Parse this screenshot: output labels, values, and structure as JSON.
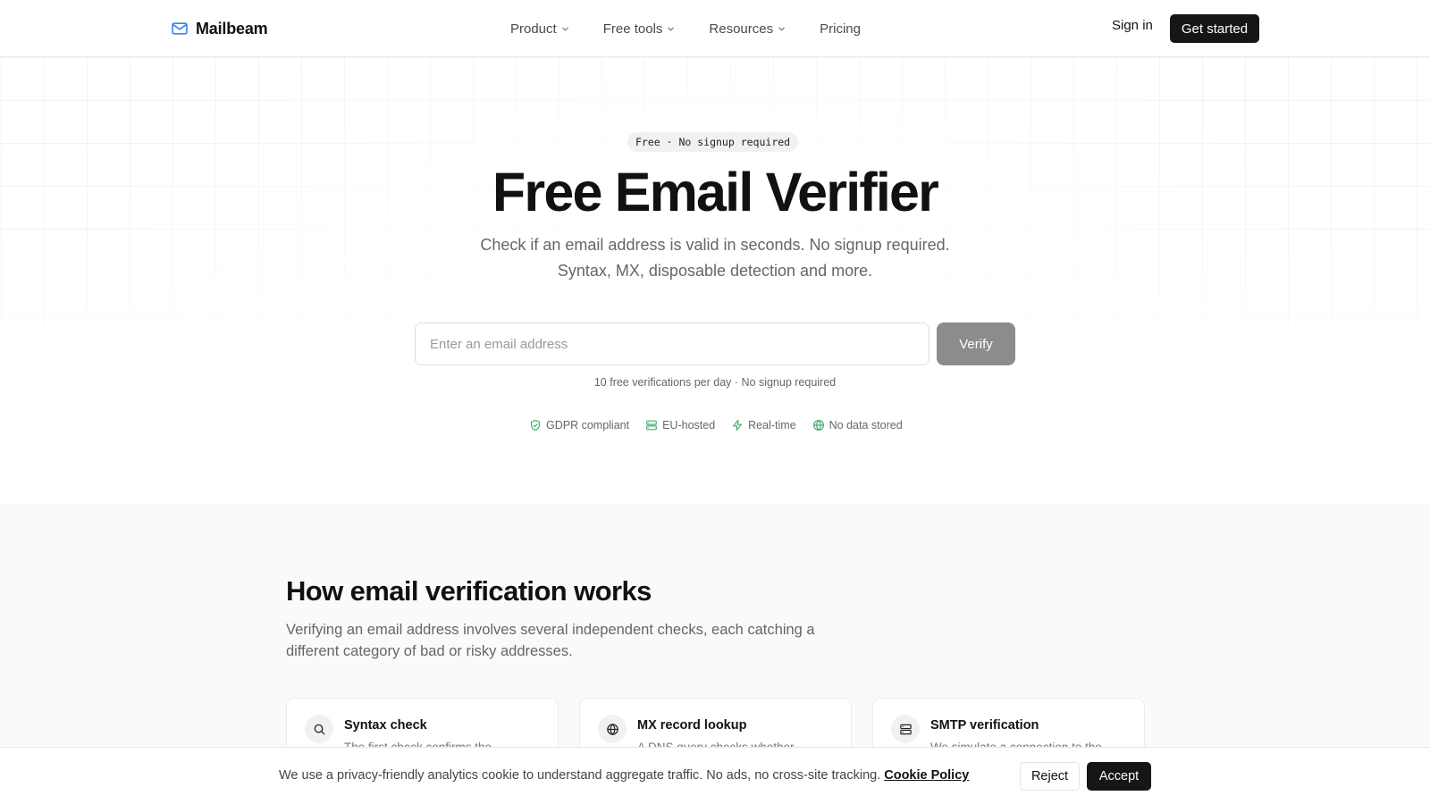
{
  "brand": {
    "name": "Mailbeam",
    "accent": "#3b82f6"
  },
  "nav": {
    "items": [
      {
        "label": "Product",
        "has_dropdown": true
      },
      {
        "label": "Free tools",
        "has_dropdown": true
      },
      {
        "label": "Resources",
        "has_dropdown": true
      },
      {
        "label": "Pricing",
        "has_dropdown": false
      }
    ],
    "sign_in": "Sign in",
    "get_started": "Get started"
  },
  "hero": {
    "badge": "Free · No signup required",
    "title": "Free Email Verifier",
    "subtitle_line1": "Check if an email address is valid in seconds. No signup required.",
    "subtitle_line2": "Syntax, MX, disposable detection and more.",
    "input_placeholder": "Enter an email address",
    "input_value": "",
    "verify_label": "Verify",
    "limit_note": "10 free verifications per day · No signup required",
    "features": [
      {
        "label": "GDPR compliant",
        "icon": "shield-check-icon"
      },
      {
        "label": "EU-hosted",
        "icon": "server-icon"
      },
      {
        "label": "Real-time",
        "icon": "zap-icon"
      },
      {
        "label": "No data stored",
        "icon": "globe-icon"
      }
    ],
    "feature_icon_color": "#3fae6a"
  },
  "how": {
    "title": "How email verification works",
    "description": "Verifying an email address involves several independent checks, each catching a different category of bad or risky addresses.",
    "cards": [
      {
        "title": "Syntax check",
        "text": "The first check confirms the",
        "icon": "search-icon"
      },
      {
        "title": "MX record lookup",
        "text": "A DNS query checks whether",
        "icon": "globe-icon"
      },
      {
        "title": "SMTP verification",
        "text": "We simulate a connection to the",
        "icon": "server-icon"
      }
    ]
  },
  "cookie": {
    "text": "We use a privacy-friendly analytics cookie to understand aggregate traffic. No ads, no cross-site tracking.",
    "policy_link": "Cookie Policy",
    "reject_label": "Reject",
    "accept_label": "Accept"
  }
}
